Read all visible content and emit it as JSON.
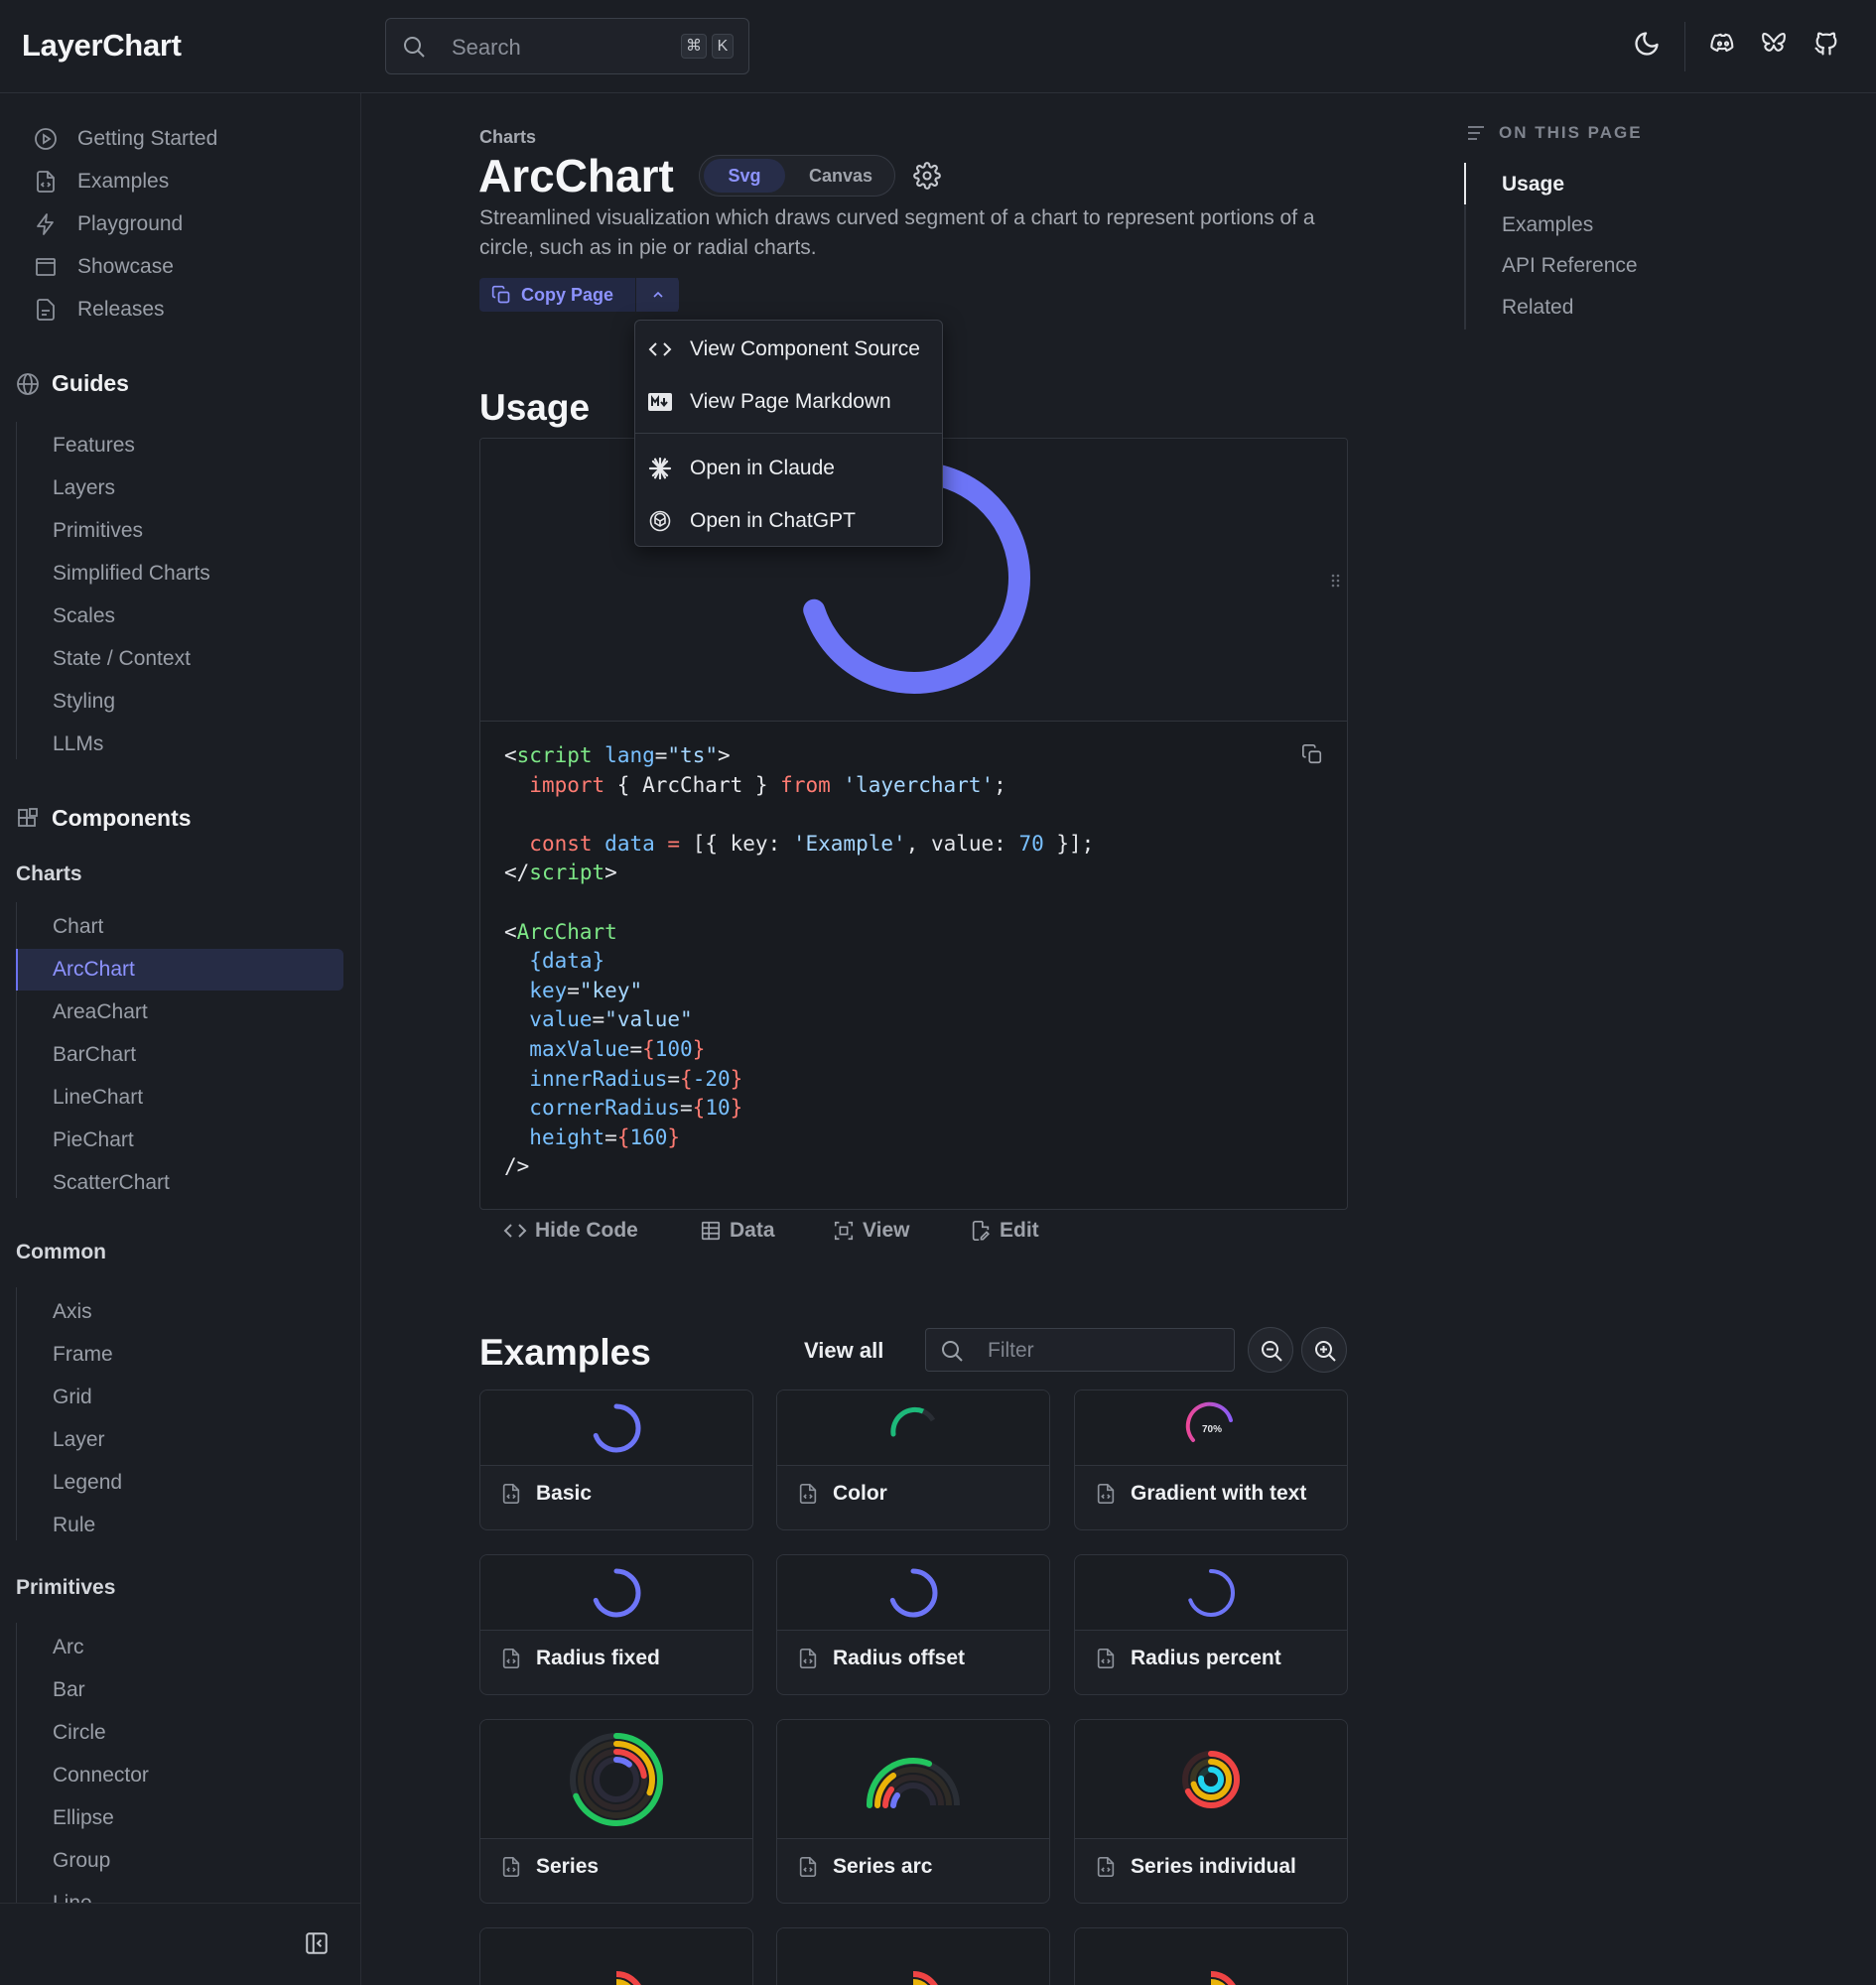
{
  "app": {
    "logo": "LayerChart",
    "search_placeholder": "Search",
    "shortcut_mod": "⌘",
    "shortcut_key": "K"
  },
  "header_icons": [
    "moon-icon",
    "discord-icon",
    "bluesky-icon",
    "github-icon"
  ],
  "sidebar": {
    "top_items": [
      {
        "label": "Getting Started",
        "icon": "play-circle-icon"
      },
      {
        "label": "Examples",
        "icon": "file-code-icon"
      },
      {
        "label": "Playground",
        "icon": "lightning-icon"
      },
      {
        "label": "Showcase",
        "icon": "window-icon"
      },
      {
        "label": "Releases",
        "icon": "notes-icon"
      }
    ],
    "guides": {
      "title": "Guides",
      "items": [
        "Features",
        "Layers",
        "Primitives",
        "Simplified Charts",
        "Scales",
        "State / Context",
        "Styling",
        "LLMs"
      ]
    },
    "components": {
      "title": "Components",
      "charts_title": "Charts",
      "charts": [
        "Chart",
        "ArcChart",
        "AreaChart",
        "BarChart",
        "LineChart",
        "PieChart",
        "ScatterChart"
      ],
      "active": "ArcChart",
      "common_title": "Common",
      "common": [
        "Axis",
        "Frame",
        "Grid",
        "Layer",
        "Legend",
        "Rule"
      ],
      "primitives_title": "Primitives",
      "primitives": [
        "Arc",
        "Bar",
        "Circle",
        "Connector",
        "Ellipse",
        "Group",
        "Line"
      ]
    }
  },
  "page": {
    "breadcrumb": "Charts",
    "title": "ArcChart",
    "toggle": {
      "svg": "Svg",
      "canvas": "Canvas",
      "selected": "Svg"
    },
    "description": "Streamlined visualization which draws curved segment of a chart to represent portions of a circle, such as in pie or radial charts.",
    "copy_page": "Copy Page",
    "copy_menu": [
      {
        "label": "View Component Source",
        "icon": "code-icon"
      },
      {
        "label": "View Page Markdown",
        "icon": "markdown-icon"
      },
      {
        "label": "Open in Claude",
        "icon": "claude-icon"
      },
      {
        "label": "Open in ChatGPT",
        "icon": "chatgpt-icon"
      }
    ],
    "usage_heading": "Usage",
    "usage_preview": {
      "value": 70,
      "max_value": 100,
      "color": "#6d75f7"
    },
    "code_actions": [
      "Hide Code",
      "Data",
      "View",
      "Edit"
    ],
    "examples_heading": "Examples",
    "view_all": "View all",
    "filter_placeholder": "Filter",
    "examples": [
      {
        "label": "Basic"
      },
      {
        "label": "Color"
      },
      {
        "label": "Gradient with text",
        "thumb_text": "70%"
      },
      {
        "label": "Radius fixed"
      },
      {
        "label": "Radius offset"
      },
      {
        "label": "Radius percent"
      },
      {
        "label": "Series"
      },
      {
        "label": "Series arc"
      },
      {
        "label": "Series individual"
      }
    ]
  },
  "toc": {
    "title": "ON THIS PAGE",
    "items": [
      "Usage",
      "Examples",
      "API Reference",
      "Related"
    ],
    "active": "Usage"
  },
  "colors": {
    "accent": "#8d93ff",
    "arc": "#6d75f7",
    "green": "#1db97a",
    "background": "#1b1e24"
  }
}
